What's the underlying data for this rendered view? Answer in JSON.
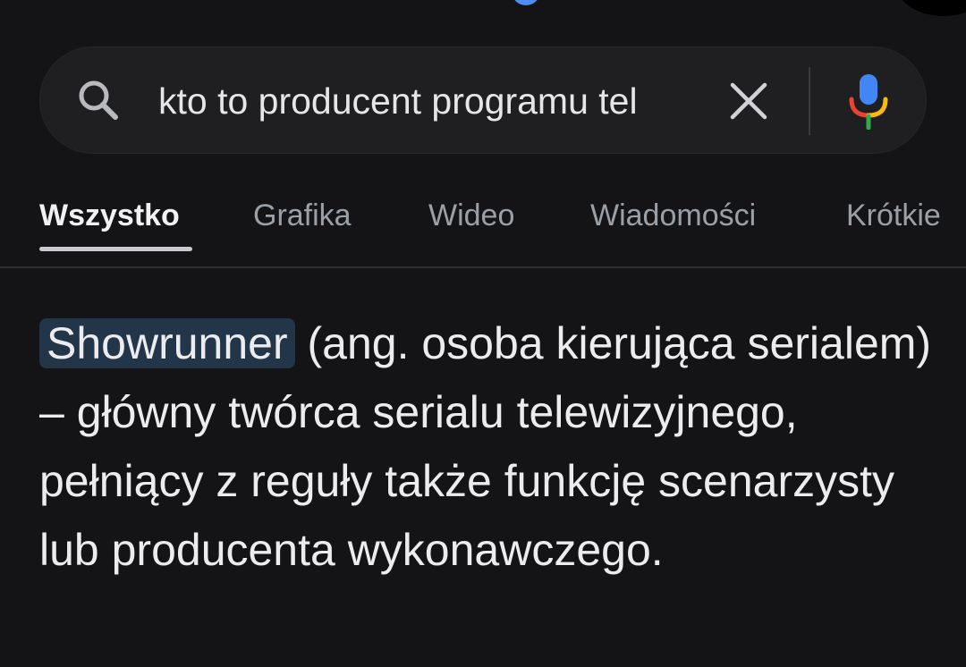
{
  "search": {
    "query": "kto to producent programu tel",
    "icon": "search-icon",
    "clear_icon": "close-icon",
    "mic_icon": "microphone-icon"
  },
  "tabs": [
    {
      "label": "Wszystko",
      "active": true
    },
    {
      "label": "Grafika",
      "active": false
    },
    {
      "label": "Wideo",
      "active": false
    },
    {
      "label": "Wiadomości",
      "active": false
    },
    {
      "label": "Krótkie",
      "active": false
    }
  ],
  "answer": {
    "highlight": "Showrunner",
    "text": " (ang. osoba kierująca serialem) – główny twórca serialu telewizyjnego, pełniący z reguły także funkcję scenarzysty lub producenta wykonawczego."
  },
  "colors": {
    "background": "#141416",
    "search_bg": "#1f1f22",
    "highlight_bg": "#233549",
    "mic_blue": "#4285f4",
    "mic_red": "#ea4335",
    "mic_yellow": "#fbbc05",
    "mic_green": "#34a853"
  }
}
